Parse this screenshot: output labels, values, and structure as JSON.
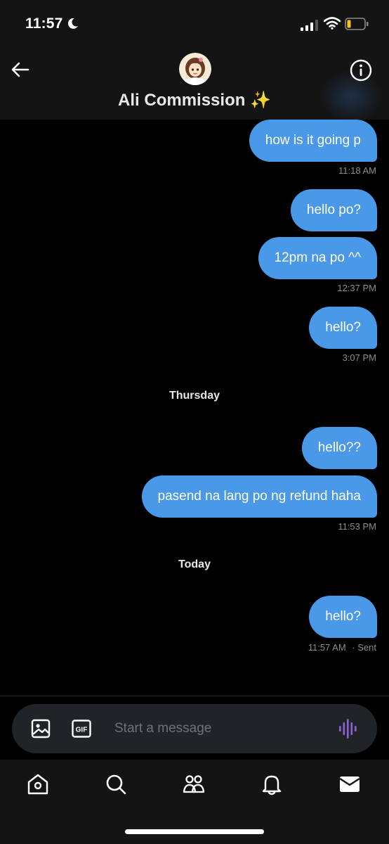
{
  "status_bar": {
    "time": "11:57",
    "battery_color": "#f5c518"
  },
  "header": {
    "title": "Ali Commission ✨"
  },
  "messages": [
    {
      "text": "how is it going p"
    },
    {
      "time": "11:18 AM"
    },
    {
      "text": "hello po?"
    },
    {
      "text": "12pm na po ^^"
    },
    {
      "time": "12:37 PM"
    },
    {
      "text": "hello?"
    },
    {
      "time": "3:07 PM"
    },
    {
      "day": "Thursday"
    },
    {
      "text": "hello??"
    },
    {
      "text": "pasend na lang po ng refund haha"
    },
    {
      "time": "11:53 PM"
    },
    {
      "day": "Today"
    },
    {
      "text": "hello?"
    },
    {
      "time": "11:57 AM",
      "status": "· Sent"
    }
  ],
  "composer": {
    "placeholder": "Start a message",
    "gif_label": "GIF"
  },
  "colors": {
    "bubble": "#4a99e9",
    "accent_voice": "#8a63d2",
    "background": "#000000"
  },
  "tabs": [
    "home-icon",
    "search-icon",
    "communities-icon",
    "notifications-icon",
    "messages-icon"
  ]
}
